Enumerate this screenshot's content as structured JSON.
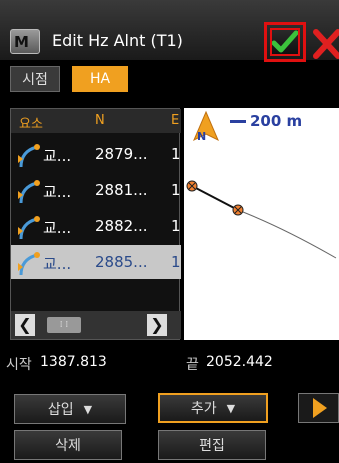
{
  "window": {
    "title": "Edit Hz Alnt (T1)",
    "app_icon_letter": "M"
  },
  "tabs": [
    {
      "label": "시점"
    },
    {
      "label": "HA"
    }
  ],
  "table": {
    "headers": [
      "요소",
      "N",
      "E"
    ],
    "rows": [
      {
        "type": "교...",
        "n": "2879...",
        "e": "1"
      },
      {
        "type": "교...",
        "n": "2881...",
        "e": "1"
      },
      {
        "type": "교...",
        "n": "2882...",
        "e": "1"
      },
      {
        "type": "교...",
        "n": "2885...",
        "e": "1"
      }
    ],
    "selected_row": 3,
    "scroll_thumb": "⁞ ⁞"
  },
  "map": {
    "scale_label": "200 m",
    "north_label": "N"
  },
  "info": {
    "start_label": "시작",
    "start_value": "1387.813",
    "end_label": "끝",
    "end_value": "2052.442"
  },
  "buttons": {
    "insert": "삽입",
    "add": "추가",
    "delete": "삭제",
    "edit": "편집"
  },
  "colors": {
    "accent": "#f0a020",
    "ok_green": "#3cc23c",
    "cancel_red": "#e02020",
    "highlight_red": "#e01010"
  }
}
